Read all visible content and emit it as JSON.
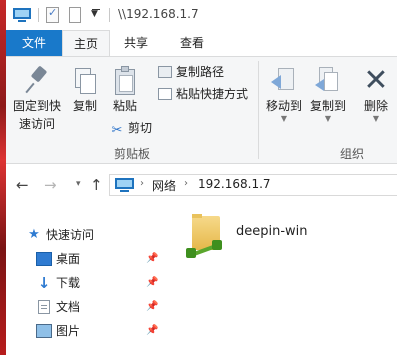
{
  "title_bar": {
    "path": "\\\\192.168.1.7"
  },
  "tabs": [
    {
      "label": "文件"
    },
    {
      "label": "主页"
    },
    {
      "label": "共享"
    },
    {
      "label": "查看"
    }
  ],
  "ribbon": {
    "clipboard": {
      "pin_label_line1": "固定到快",
      "pin_label_line2": "速访问",
      "copy": "复制",
      "paste": "粘贴",
      "copy_path": "复制路径",
      "paste_shortcut": "粘贴快捷方式",
      "cut": "剪切",
      "group_label": "剪贴板"
    },
    "organize": {
      "move_to": "移动到",
      "copy_to": "复制到",
      "delete": "删除",
      "group_label": "组织"
    }
  },
  "address": {
    "breadcrumbs": [
      "网络",
      "192.168.1.7"
    ]
  },
  "nav_pane": {
    "quick_access": "快速访问",
    "items": [
      {
        "label": "桌面",
        "icon": "desktop-icon",
        "pinned": true
      },
      {
        "label": "下载",
        "icon": "download-icon",
        "pinned": true
      },
      {
        "label": "文档",
        "icon": "document-icon",
        "pinned": true
      },
      {
        "label": "图片",
        "icon": "picture-icon",
        "pinned": true
      }
    ]
  },
  "content": {
    "items": [
      {
        "name": "deepin-win",
        "icon": "shared-folder-icon"
      }
    ]
  },
  "colors": {
    "file_tab": "#1979ca",
    "accent": "#2f7bd1"
  }
}
